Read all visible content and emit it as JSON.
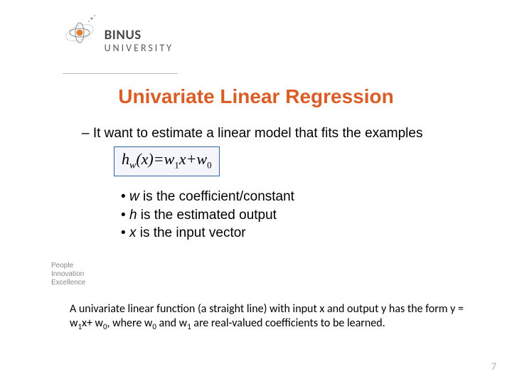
{
  "logo": {
    "brand": "BINUS",
    "sub": "UNIVERSITY"
  },
  "title": "Univariate Linear Regression",
  "dash_line": "–  It want to estimate a linear model that fits the examples",
  "formula": {
    "h": "h",
    "w_sub": "w",
    "x_arg": "(x)",
    "eq": "=",
    "w1": "w",
    "s1": "1",
    "xterm": "x",
    "plus": "+",
    "w0": "w",
    "s0": "0"
  },
  "bullets": {
    "b1_var": "w",
    "b1_rest": " is the coefficient/constant",
    "b2_var": "h",
    "b2_rest": " is the estimated output",
    "b3_var": "x",
    "b3_rest": " is the input vector"
  },
  "tagline": {
    "l1": "People",
    "l2": "Innovation",
    "l3": "Excellence"
  },
  "summary": {
    "p1": "A univariate linear function (a straight line) with input x and output y has the",
    "p2a": "form y = w",
    "s1": "1",
    "p2b": "x+ w",
    "s0": "0",
    "p2c": ", where w",
    "s0b": "0",
    "p2d": " and w",
    "s1b": "1",
    "p2e": " are real-valued coefficients to be learned."
  },
  "page_number": "7"
}
